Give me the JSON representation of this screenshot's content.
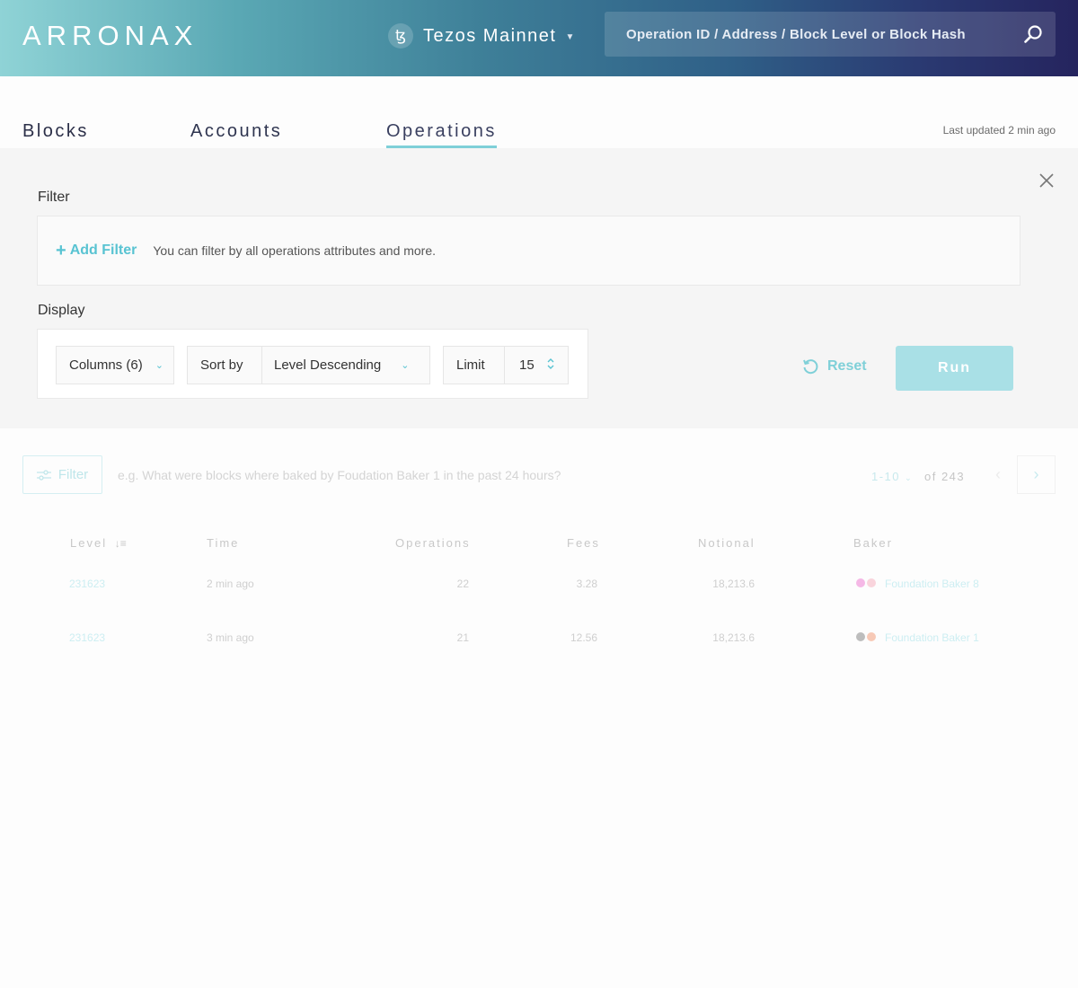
{
  "header": {
    "logo": "ARRONAX",
    "network_symbol": "ꜩ",
    "network": "Tezos Mainnet",
    "search_placeholder": "Operation ID / Address / Block Level or Block Hash"
  },
  "tabs": [
    {
      "label": "Blocks"
    },
    {
      "label": "Accounts"
    },
    {
      "label": "Operations"
    }
  ],
  "last_updated": "Last updated 2 min ago",
  "filter": {
    "title": "Filter",
    "add_label": "Add Filter",
    "hint": "You can filter by all operations attributes and more."
  },
  "display": {
    "title": "Display",
    "columns_label": "Columns (6)",
    "sort_label": "Sort by",
    "sort_value": "Level Descending",
    "limit_label": "Limit",
    "limit_value": "15"
  },
  "actions": {
    "reset": "Reset",
    "run": "Run"
  },
  "results": {
    "filter_button": "Filter",
    "query_placeholder": "e.g. What were blocks where baked by Foudation Baker 1 in the past 24 hours?",
    "range": "1-10",
    "total": "of 243",
    "columns": [
      "Level",
      "Time",
      "Operations",
      "Fees",
      "Notional",
      "Baker"
    ],
    "rows": [
      {
        "level": "231623",
        "time": "2 min ago",
        "operations": "22",
        "fees": "3.28",
        "notional": "18,213.6",
        "baker": "Foundation Baker 8",
        "dot_colors": [
          "#f5b8e6",
          "#f9d4dc"
        ]
      },
      {
        "level": "231623",
        "time": "3 min ago",
        "operations": "21",
        "fees": "12.56",
        "notional": "18,213.6",
        "baker": "Foundation Baker 1",
        "dot_colors": [
          "#bdbdbd",
          "#f7c9b6"
        ]
      }
    ]
  },
  "colors": {
    "accent": "#58c3d2",
    "run_button": "#a9e0e6",
    "tab_underline": "#7fd0d8"
  }
}
